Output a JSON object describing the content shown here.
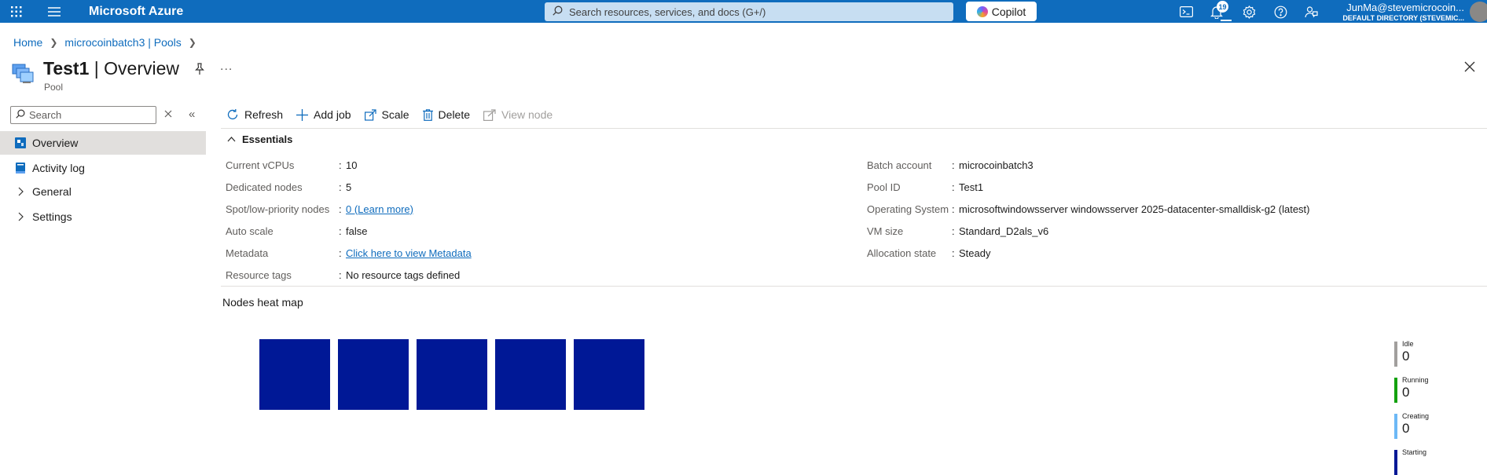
{
  "topbar": {
    "brand": "Microsoft Azure",
    "search_placeholder": "Search resources, services, and docs (G+/)",
    "copilot_label": "Copilot",
    "notification_count": "19",
    "user_name": "JunMa@stevemicrocoin...",
    "user_directory": "DEFAULT DIRECTORY (STEVEMIC..."
  },
  "breadcrumb": {
    "home": "Home",
    "parent": "microcoinbatch3 | Pools"
  },
  "header": {
    "title_bold": "Test1",
    "title_rest": " | Overview",
    "subtitle": "Pool",
    "more": "..."
  },
  "nav": {
    "search_placeholder": "Search",
    "items": [
      {
        "label": "Overview",
        "icon": "overview-icon"
      },
      {
        "label": "Activity log",
        "icon": "activity-log-icon"
      },
      {
        "label": "General",
        "icon": "chevron-right-icon"
      },
      {
        "label": "Settings",
        "icon": "chevron-right-icon"
      }
    ]
  },
  "toolbar": {
    "refresh": "Refresh",
    "add_job": "Add job",
    "scale": "Scale",
    "delete": "Delete",
    "view_node": "View node"
  },
  "essentials": {
    "heading": "Essentials",
    "left": [
      {
        "key": "Current vCPUs",
        "value": "10"
      },
      {
        "key": "Dedicated nodes",
        "value": "5"
      },
      {
        "key": "Spot/low-priority nodes",
        "value": "0 (Learn more)"
      },
      {
        "key": "Auto scale",
        "value": "false"
      },
      {
        "key": "Metadata",
        "value": "Click here to view Metadata"
      },
      {
        "key": "Resource tags",
        "value": "No resource tags defined"
      }
    ],
    "right": [
      {
        "key": "Batch account",
        "value": "microcoinbatch3"
      },
      {
        "key": "Pool ID",
        "value": "Test1"
      },
      {
        "key": "Operating System",
        "value": "microsoftwindowsserver windowsserver 2025-datacenter-smalldisk-g2 (latest)"
      },
      {
        "key": "VM size",
        "value": "Standard_D2als_v6"
      },
      {
        "key": "Allocation state",
        "value": "Steady"
      }
    ]
  },
  "heatmap": {
    "title": "Nodes heat map",
    "node_color": "#001896",
    "node_count": 5,
    "legend": [
      {
        "name": "Idle",
        "value": "0",
        "color": "#a19f9d"
      },
      {
        "name": "Running",
        "value": "0",
        "color": "#13a10e"
      },
      {
        "name": "Creating",
        "value": "0",
        "color": "#6cb8f6"
      },
      {
        "name": "Starting",
        "value": "",
        "color": "#001896"
      }
    ]
  }
}
